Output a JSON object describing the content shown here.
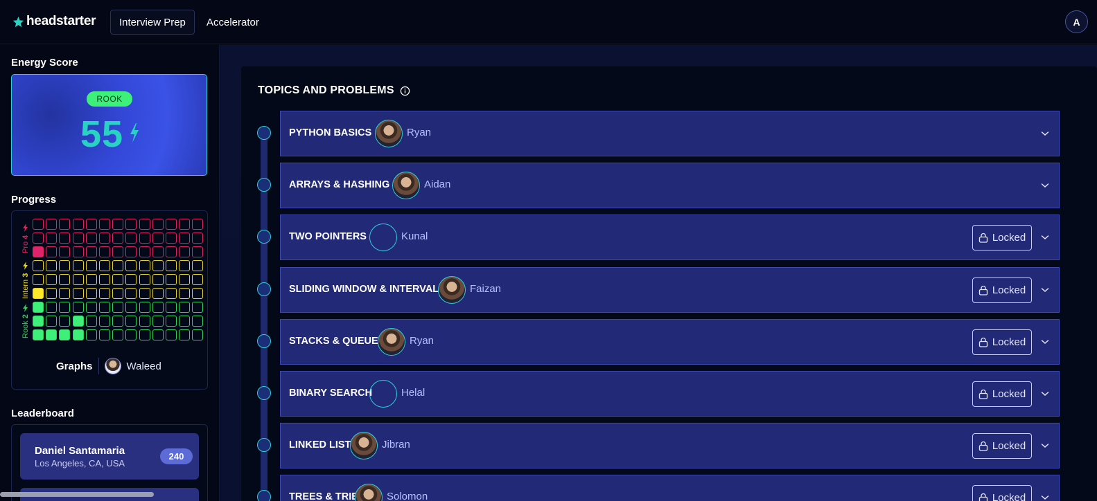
{
  "header": {
    "logo_text": "headstarter",
    "tabs": [
      {
        "label": "Interview Prep",
        "active": true
      },
      {
        "label": "Accelerator",
        "active": false
      }
    ],
    "user_initial": "A"
  },
  "sidebar": {
    "energy": {
      "title": "Energy Score",
      "rank": "ROOK",
      "value": "55",
      "accent": "#29d3c4"
    },
    "progress": {
      "title": "Progress",
      "levels": [
        {
          "label": "Pro",
          "number": "4",
          "color": "#e0245e"
        },
        {
          "label": "Intern",
          "number": "3",
          "color": "#e5d22a"
        },
        {
          "label": "Rook",
          "number": "2",
          "color": "#2fd15a"
        }
      ],
      "graphs_label": "Graphs",
      "mentor": "Waleed"
    },
    "leaderboard": {
      "title": "Leaderboard",
      "entries": [
        {
          "name": "Daniel Santamaria",
          "location": "Los Angeles, CA, USA",
          "score": "240"
        }
      ]
    }
  },
  "main": {
    "title": "TOPICS AND PROBLEMS",
    "topics": [
      {
        "name": "PYTHON BASICS",
        "mentor": "Ryan",
        "locked": false,
        "avatar": "face"
      },
      {
        "name": "ARRAYS & HASHING",
        "mentor": "Aidan",
        "locked": false,
        "avatar": "face"
      },
      {
        "name": "TWO POINTERS",
        "mentor": "Kunal",
        "locked": true,
        "avatar": "empty"
      },
      {
        "name": "SLIDING WINDOW & INTERVALS",
        "mentor": "Faizan",
        "locked": true,
        "avatar": "face"
      },
      {
        "name": "STACKS & QUEUES",
        "mentor": "Ryan",
        "locked": true,
        "avatar": "face"
      },
      {
        "name": "BINARY SEARCH",
        "mentor": "Helal",
        "locked": true,
        "avatar": "empty"
      },
      {
        "name": "LINKED LISTS",
        "mentor": "Jibran",
        "locked": true,
        "avatar": "face"
      },
      {
        "name": "TREES & TRIES",
        "mentor": "Solomon",
        "locked": true,
        "avatar": "face"
      }
    ],
    "locked_label": "Locked"
  }
}
